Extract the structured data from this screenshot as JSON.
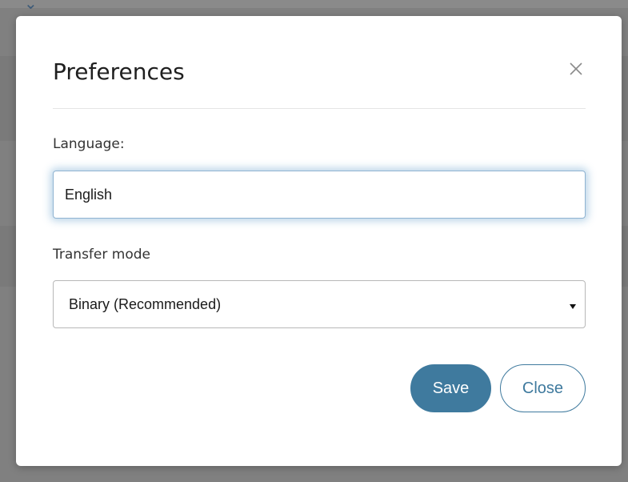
{
  "dialog": {
    "title": "Preferences",
    "close_icon": "close-icon"
  },
  "language": {
    "label": "Language:",
    "value": "English"
  },
  "transfer_mode": {
    "label": "Transfer mode",
    "selected": "Binary (Recommended)",
    "caret_icon": "caret-down-icon"
  },
  "actions": {
    "save_label": "Save",
    "close_label": "Close"
  },
  "colors": {
    "accent": "#3f7a9e",
    "overlay": "#808080",
    "focus_border": "#8fb3d1"
  }
}
